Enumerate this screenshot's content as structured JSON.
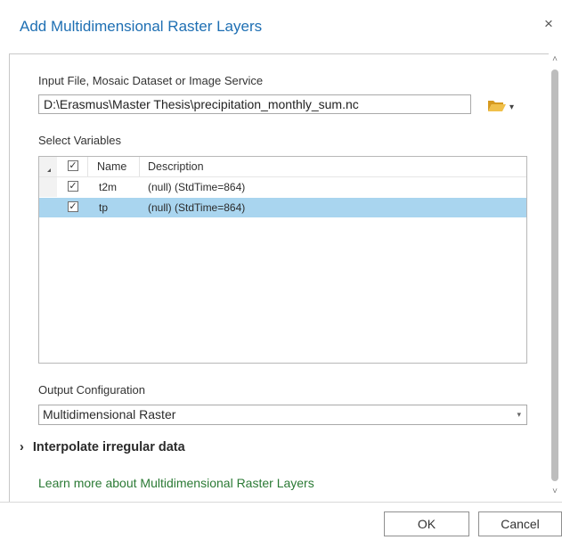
{
  "dialog": {
    "title": "Add Multidimensional Raster Layers",
    "close_glyph": "×"
  },
  "input": {
    "label": "Input File, Mosaic Dataset or Image Service",
    "value": "D:\\Erasmus\\Master Thesis\\precipitation_monthly_sum.nc",
    "browse_icon": "folder-open-icon",
    "dropdown_glyph": "▾"
  },
  "variables": {
    "label": "Select Variables",
    "columns": {
      "name": "Name",
      "description": "Description"
    },
    "header_checked": "✓",
    "rows": [
      {
        "checked": "✓",
        "name": "t2m",
        "description": "(null) (StdTime=864)",
        "selected": false
      },
      {
        "checked": "✓",
        "name": "tp",
        "description": "(null) (StdTime=864)",
        "selected": true
      }
    ]
  },
  "output": {
    "label": "Output Configuration",
    "value": "Multidimensional Raster",
    "arrow_glyph": "▾"
  },
  "interpolate": {
    "label": "Interpolate irregular data",
    "chevron": "›"
  },
  "learn_more": "Learn more about Multidimensional Raster Layers",
  "buttons": {
    "ok": "OK",
    "cancel": "Cancel"
  },
  "scrollbar": {
    "up": "˄",
    "down": "˅"
  },
  "colors": {
    "title": "#1e6fb3",
    "selected_row": "#a9d5ef",
    "link": "#2b7a35",
    "folder": "#e8b335"
  }
}
